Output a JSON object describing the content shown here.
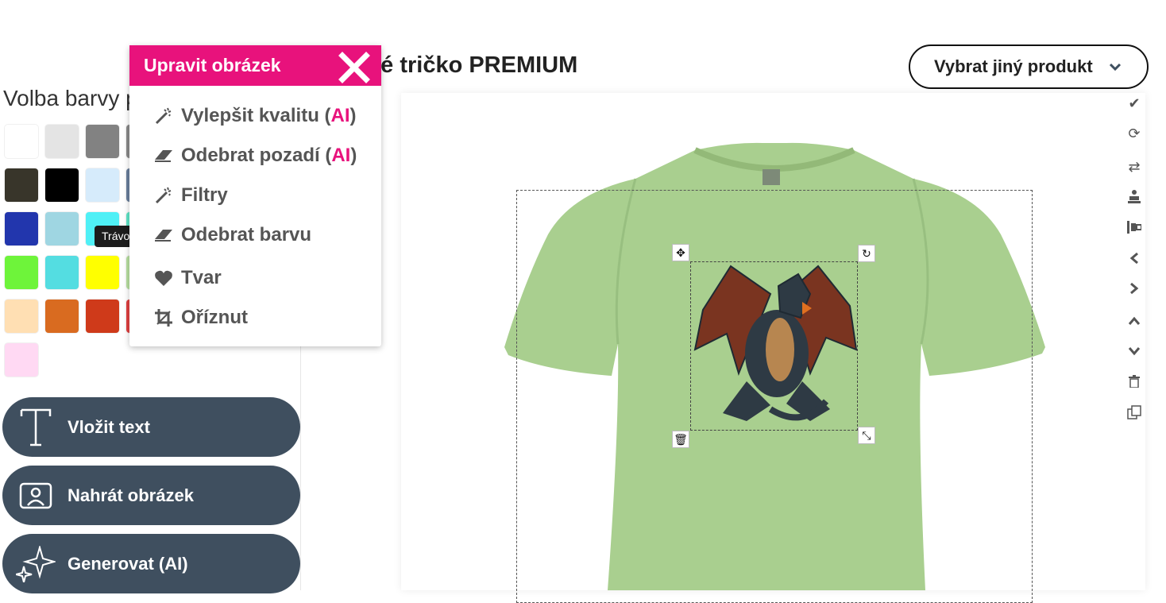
{
  "left_panel": {
    "color_label": "Volba barvy p",
    "tooltip": "Trávo",
    "swatches": [
      {
        "color": "#ffffff"
      },
      {
        "color": "#e4e4e4"
      },
      {
        "color": "#828282"
      },
      {
        "color": "#8a8a8a"
      },
      {
        "color": "#38352a"
      },
      {
        "color": "#000000"
      },
      {
        "color": "#d6ebfb"
      },
      {
        "color": "#6a7f9c"
      },
      {
        "color": "#2236ad"
      },
      {
        "color": "#9fd6e2"
      },
      {
        "color": "#4ff0f6"
      },
      {
        "color": "#5ee6c8"
      },
      {
        "color": "#6ef43a"
      },
      {
        "color": "#54dde1"
      },
      {
        "color": "#ffff00"
      },
      {
        "color": "#b8e0a0"
      },
      {
        "color": "#ffdfb3"
      },
      {
        "color": "#d96b20"
      },
      {
        "color": "#cf3a1a"
      },
      {
        "color": "#e04040"
      },
      {
        "color": "#ffd9f3"
      }
    ],
    "actions": [
      {
        "label": "Vložit text",
        "icon": "text-icon"
      },
      {
        "label": "Nahrát obrázek",
        "icon": "upload-image-icon"
      },
      {
        "label": "Generovat (AI)",
        "icon": "sparkles-icon"
      }
    ]
  },
  "header": {
    "product_title": "ké tričko PREMIUM",
    "select_label": "Vybrat jiný produkt",
    "select_icon": "chevron-down-icon"
  },
  "popup": {
    "title": "Upravit obrázek",
    "close_icon": "close-icon",
    "items": [
      {
        "label": "Vylepšit kvalitu (",
        "ai": "AI",
        "suffix": ")",
        "icon": "magic-wand-icon"
      },
      {
        "label": "Odebrat pozadí (",
        "ai": "AI",
        "suffix": ")",
        "icon": "eraser-icon"
      },
      {
        "label": "Filtry",
        "ai": "",
        "suffix": "",
        "icon": "magic-wand-icon"
      },
      {
        "label": "Odebrat barvu",
        "ai": "",
        "suffix": "",
        "icon": "eraser-icon"
      },
      {
        "label": "Tvar",
        "ai": "",
        "suffix": "",
        "icon": "heart-icon"
      },
      {
        "label": "Oříznut",
        "ai": "",
        "suffix": "",
        "icon": "crop-icon"
      }
    ]
  },
  "canvas": {
    "shirt_color": "#a9cf8f",
    "handles": [
      "move-icon",
      "rotate-icon",
      "delete-icon",
      "resize-icon"
    ]
  },
  "toolbar": {
    "tools": [
      "check-icon",
      "refresh-icon",
      "swap-icon",
      "stamp-icon",
      "align-icon",
      "chevron-left-icon",
      "chevron-right-icon",
      "chevron-up-icon",
      "chevron-down-icon",
      "trash-icon",
      "copy-icon"
    ]
  },
  "colors": {
    "accent": "#e8127c",
    "button": "#3f4f5f"
  }
}
